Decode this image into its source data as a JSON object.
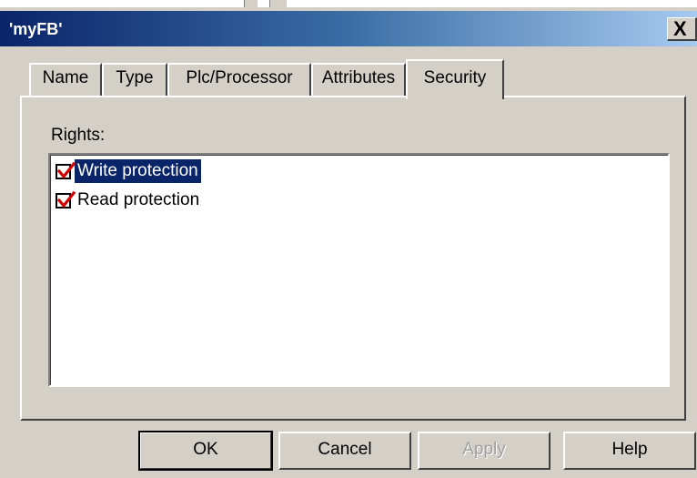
{
  "window": {
    "title": "'myFB'",
    "close_glyph": "X"
  },
  "tabs": [
    {
      "label": "Name",
      "active": false
    },
    {
      "label": "Type",
      "active": false
    },
    {
      "label": "Plc/Processor",
      "active": false
    },
    {
      "label": "Attributes",
      "active": false
    },
    {
      "label": "Security",
      "active": true
    }
  ],
  "security": {
    "rights_label": "Rights:",
    "items": [
      {
        "label": "Write protection",
        "checked": true,
        "selected": true
      },
      {
        "label": "Read protection",
        "checked": true,
        "selected": false
      }
    ]
  },
  "buttons": {
    "ok": "OK",
    "cancel": "Cancel",
    "apply": "Apply",
    "help": "Help"
  },
  "colors": {
    "face": "#d4d0c8",
    "title_start": "#0a246a",
    "title_end": "#a6caf0",
    "selection": "#0a246a",
    "check_mark": "#d40000"
  }
}
